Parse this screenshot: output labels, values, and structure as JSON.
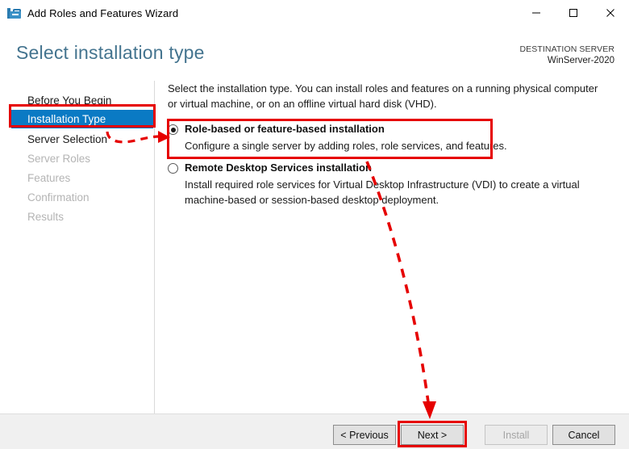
{
  "window": {
    "title": "Add Roles and Features Wizard",
    "icon": "server-toolbox-icon",
    "controls": {
      "minimize": "minimize-icon",
      "maximize": "maximize-icon",
      "close": "close-icon"
    }
  },
  "header": {
    "title": "Select installation type",
    "destination_label": "DESTINATION SERVER",
    "destination_value": "WinServer-2020"
  },
  "sidebar": {
    "items": [
      {
        "label": "Before You Begin",
        "state": "normal"
      },
      {
        "label": "Installation Type",
        "state": "selected"
      },
      {
        "label": "Server Selection",
        "state": "normal"
      },
      {
        "label": "Server Roles",
        "state": "disabled"
      },
      {
        "label": "Features",
        "state": "disabled"
      },
      {
        "label": "Confirmation",
        "state": "disabled"
      },
      {
        "label": "Results",
        "state": "disabled"
      }
    ]
  },
  "main": {
    "intro": "Select the installation type. You can install roles and features on a running physical computer or virtual machine, or on an offline virtual hard disk (VHD).",
    "options": [
      {
        "title": "Role-based or feature-based installation",
        "description": "Configure a single server by adding roles, role services, and features.",
        "selected": true
      },
      {
        "title": "Remote Desktop Services installation",
        "description": "Install required role services for Virtual Desktop Infrastructure (VDI) to create a virtual machine-based or session-based desktop deployment.",
        "selected": false
      }
    ]
  },
  "footer": {
    "previous_label": "< Previous",
    "next_label": "Next >",
    "install_label": "Install",
    "cancel_label": "Cancel",
    "install_disabled": true
  },
  "annotations": {
    "color": "#e60000",
    "boxes": [
      "installation-type-nav",
      "role-based-option",
      "next-button"
    ],
    "arrows": [
      "nav-to-option-arrow",
      "option-to-next-arrow"
    ]
  }
}
